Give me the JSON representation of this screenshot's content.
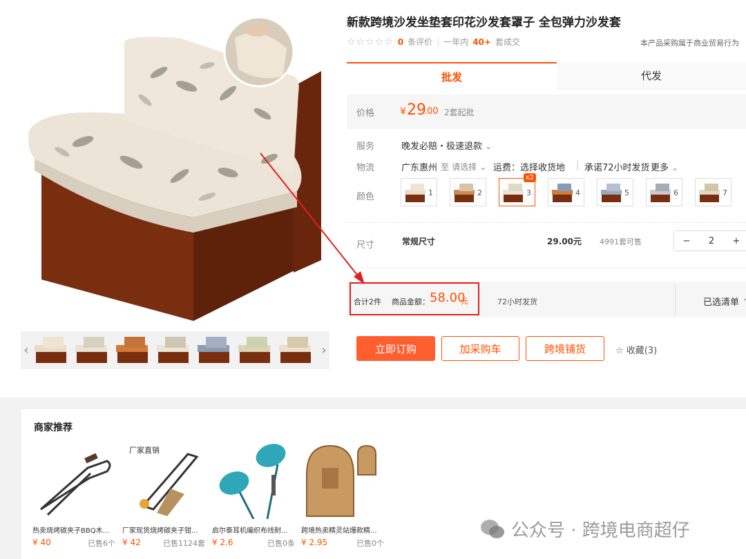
{
  "product": {
    "title": "新款跨境沙发坐垫套印花沙发套罩子 全包弹力沙发套",
    "rating_count": "0",
    "rating_label": "条评价",
    "period_label": "一年内",
    "deals_count": "40+",
    "deals_label": "套成交",
    "purchase_note": "本产品采购属于商业贸易行为"
  },
  "tabs": [
    {
      "label": "批发",
      "active": true
    },
    {
      "label": "代发",
      "active": false
    }
  ],
  "price": {
    "label": "价格",
    "symbol": "¥",
    "integer": "29",
    "decimal": ".00",
    "moq": "2套起批"
  },
  "service": {
    "label": "服务",
    "value": "晚发必赔・极速退款"
  },
  "logistics": {
    "label": "物流",
    "from": "广东惠州",
    "to_label": "至",
    "to_select": "请选择",
    "shipping": "运费：选择收货地",
    "promise": "承诺72小时发货",
    "more": "更多"
  },
  "color": {
    "label": "颜色",
    "options": [
      "1",
      "2",
      "3",
      "4",
      "5",
      "6",
      "7"
    ],
    "selected_badge": "x2"
  },
  "size": {
    "label": "尺寸",
    "name": "常规尺寸",
    "price": "29.00元",
    "stock": "4991套可售",
    "qty": "2",
    "minus": "−",
    "plus": "+"
  },
  "summary": {
    "count": "合计2件",
    "amount_label": "商品金额：",
    "amount": "58.00",
    "unit": "元",
    "ship": "72小时发货",
    "selected_list": "已选清单"
  },
  "actions": {
    "buy": "立即订购",
    "cart": "加采购车",
    "cross": "跨境铺货",
    "fav": "收藏(3)"
  },
  "thumbs": {
    "prev": "‹",
    "next": "›",
    "count": 7
  },
  "recommend": {
    "title": "商家推荐",
    "items": [
      {
        "name": "热卖烧烤碳夹子BBQ木...",
        "price": "¥ 40",
        "sold": "已售6个",
        "tag": ""
      },
      {
        "name": "厂家现货烧烤碳夹子钳...",
        "price": "¥ 42",
        "sold": "已售1124套",
        "tag": "厂家直销"
      },
      {
        "name": "启尔泰耳机编织布线耐...",
        "price": "¥ 2.6",
        "sold": "已售0条",
        "tag": ""
      },
      {
        "name": "跨境热卖精灵站爆款精...",
        "price": "¥ 2.95",
        "sold": "已售0个",
        "tag": ""
      }
    ]
  },
  "watermark": "公众号 · 跨境电商超仔",
  "colors": {
    "accent": "#ff5000",
    "highlight": "#e02020",
    "wood": "#7a2e10",
    "fabric": "#ece4d6"
  }
}
